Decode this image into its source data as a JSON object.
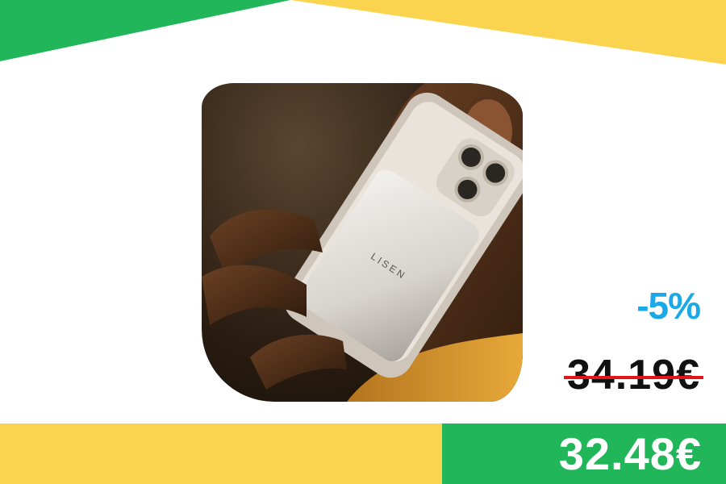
{
  "colors": {
    "green": "#22b65a",
    "yellow": "#fbd44f",
    "discount_blue": "#1aa9e6",
    "strike_red": "#e3141b"
  },
  "product": {
    "brand_text": "LISEN",
    "image_description": "hand holding phone with magnetic power bank attached"
  },
  "pricing": {
    "discount": "-5%",
    "old_price": "34.19€",
    "new_price": "32.48€"
  }
}
